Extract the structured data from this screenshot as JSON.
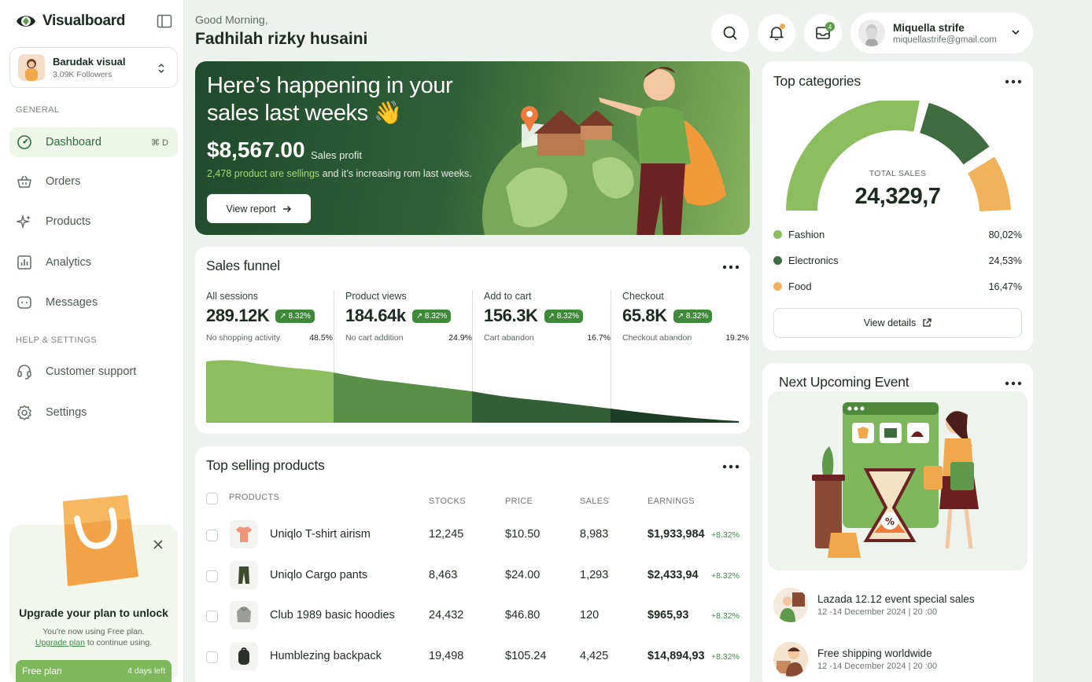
{
  "app": {
    "name": "Visualboard"
  },
  "workspace": {
    "name": "Barudak visual",
    "followers": "3.09K Followers"
  },
  "sidebar": {
    "general_label": "GENERAL",
    "help_label": "HELP & SETTINGS",
    "items": [
      {
        "label": "Dashboard",
        "shortcut": "⌘ D"
      },
      {
        "label": "Orders"
      },
      {
        "label": "Products"
      },
      {
        "label": "Analytics"
      },
      {
        "label": "Messages"
      }
    ],
    "help_items": [
      {
        "label": "Customer support"
      },
      {
        "label": "Settings"
      }
    ]
  },
  "upgrade": {
    "title": "Upgrade your plan to unlock",
    "text": "You're now using Free plan.",
    "link": "Upgrade plan",
    "text_after": " to continue using.",
    "plan_name": "Free plan",
    "days_left": "4 days left"
  },
  "header": {
    "greeting": "Good Morning,",
    "user_full_name": "Fadhilah rizky husaini",
    "messages_badge": "4"
  },
  "user": {
    "name": "Miquella strife",
    "email": "miquellastrife@gmail.com"
  },
  "hero": {
    "title": "Here’s happening in your sales last weeks 👋",
    "amount": "$8,567.00",
    "amount_label": "Sales profit",
    "note_highlight": "2,478 product are sellings",
    "note_rest": " and it’s increasing rom last weeks.",
    "button": "View report"
  },
  "funnel": {
    "title": "Sales funnel",
    "columns": [
      {
        "label": "All sessions",
        "value": "289.12K",
        "change": "↗ 8.32%",
        "sub": "No shopping activity",
        "pct": "48.5%"
      },
      {
        "label": "Product views",
        "value": "184.64k",
        "change": "↗ 8.32%",
        "sub": "No cart addition",
        "pct": "24.9%"
      },
      {
        "label": "Add to cart",
        "value": "156.3K",
        "change": "↗ 8.32%",
        "sub": "Cart abandon",
        "pct": "16.7%"
      },
      {
        "label": "Checkout",
        "value": "65.8K",
        "change": "↗ 8.32%",
        "sub": "Checkout abandon",
        "pct": "19.2%"
      }
    ]
  },
  "products": {
    "title": "Top selling products",
    "headers": {
      "product": "PRODUCTS",
      "stocks": "STOCKS",
      "price": "PRICE",
      "sales": "SALES",
      "earnings": "EARNINGS"
    },
    "rows": [
      {
        "name": "Uniqlo T-shirt airism",
        "stocks": "12,245",
        "price": "$10.50",
        "sales": "8,983",
        "earnings": "$1,933,984",
        "change": "+8.32%"
      },
      {
        "name": "Uniqlo Cargo pants",
        "stocks": "8,463",
        "price": "$24.00",
        "sales": "1,293",
        "earnings": "$2,433,94",
        "change": "+8.32%"
      },
      {
        "name": "Club 1989 basic hoodies",
        "stocks": "24,432",
        "price": "$46.80",
        "sales": "120",
        "earnings": "$965,93",
        "change": "+8.32%"
      },
      {
        "name": "Humblezing backpack",
        "stocks": "19,498",
        "price": "$105.24",
        "sales": "4,425",
        "earnings": "$14,894,93",
        "change": "+8.32%"
      }
    ]
  },
  "categories": {
    "title": "Top categories",
    "total_label": "TOTAL SALES",
    "total": "24,329,7",
    "items": [
      {
        "name": "Fashion",
        "value": "80,02%",
        "color": "#8cbd5f"
      },
      {
        "name": "Electronics",
        "value": "24,53%",
        "color": "#3f6b41"
      },
      {
        "name": "Food",
        "value": "16,47%",
        "color": "#f0b25b"
      }
    ],
    "button": "View details"
  },
  "events": {
    "title": "Next Upcoming Event",
    "items": [
      {
        "title": "Lazada 12.12 event special sales",
        "date": "12 -14 December 2024  | 20 :00"
      },
      {
        "title": "Free shipping worldwide",
        "date": "12 -14 December 2024  | 20 :00"
      }
    ]
  }
}
